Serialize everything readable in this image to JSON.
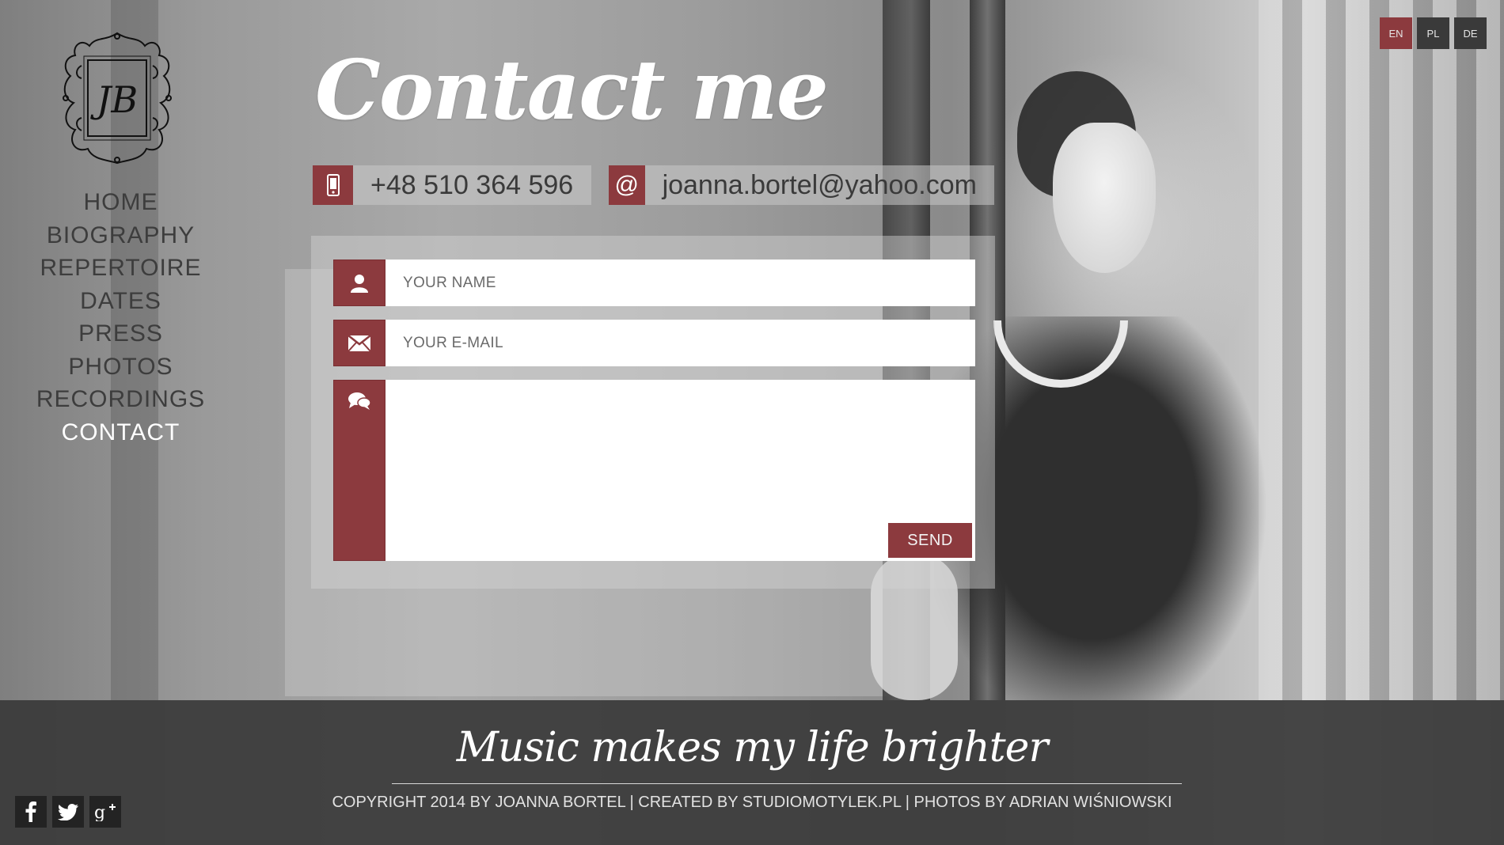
{
  "language": {
    "options": [
      "EN",
      "PL",
      "DE"
    ],
    "active": "EN"
  },
  "logo": {
    "monogram": "JB"
  },
  "nav": {
    "items": [
      "HOME",
      "BIOGRAPHY",
      "REPERTOIRE",
      "DATES",
      "PRESS",
      "PHOTOS",
      "RECORDINGS",
      "CONTACT"
    ],
    "active": "CONTACT"
  },
  "page": {
    "title": "Contact me"
  },
  "contact": {
    "phone": "+48 510 364 596",
    "email": "joanna.bortel@yahoo.com",
    "phone_icon": "mobile-phone-icon",
    "email_icon": "at-sign-icon"
  },
  "form": {
    "name_placeholder": "YOUR NAME",
    "email_placeholder": "YOUR E-MAIL",
    "message_placeholder": "",
    "send_label": "SEND",
    "name_icon": "user-icon",
    "email_icon": "envelope-icon",
    "message_icon": "speech-bubbles-icon"
  },
  "footer": {
    "slogan": "Music makes my life brighter",
    "copyright": "COPYRIGHT 2014 BY JOANNA BORTEL | CREATED BY STUDIOMOTYLEK.PL | PHOTOS BY ADRIAN WIŚNIOWSKI",
    "social": [
      "facebook-icon",
      "twitter-icon",
      "google-plus-icon"
    ]
  },
  "colors": {
    "accent": "#8c3a3e",
    "footer_bg": "#3a3a3a",
    "nav_text": "#3d3d3d",
    "nav_active": "#ffffff"
  }
}
